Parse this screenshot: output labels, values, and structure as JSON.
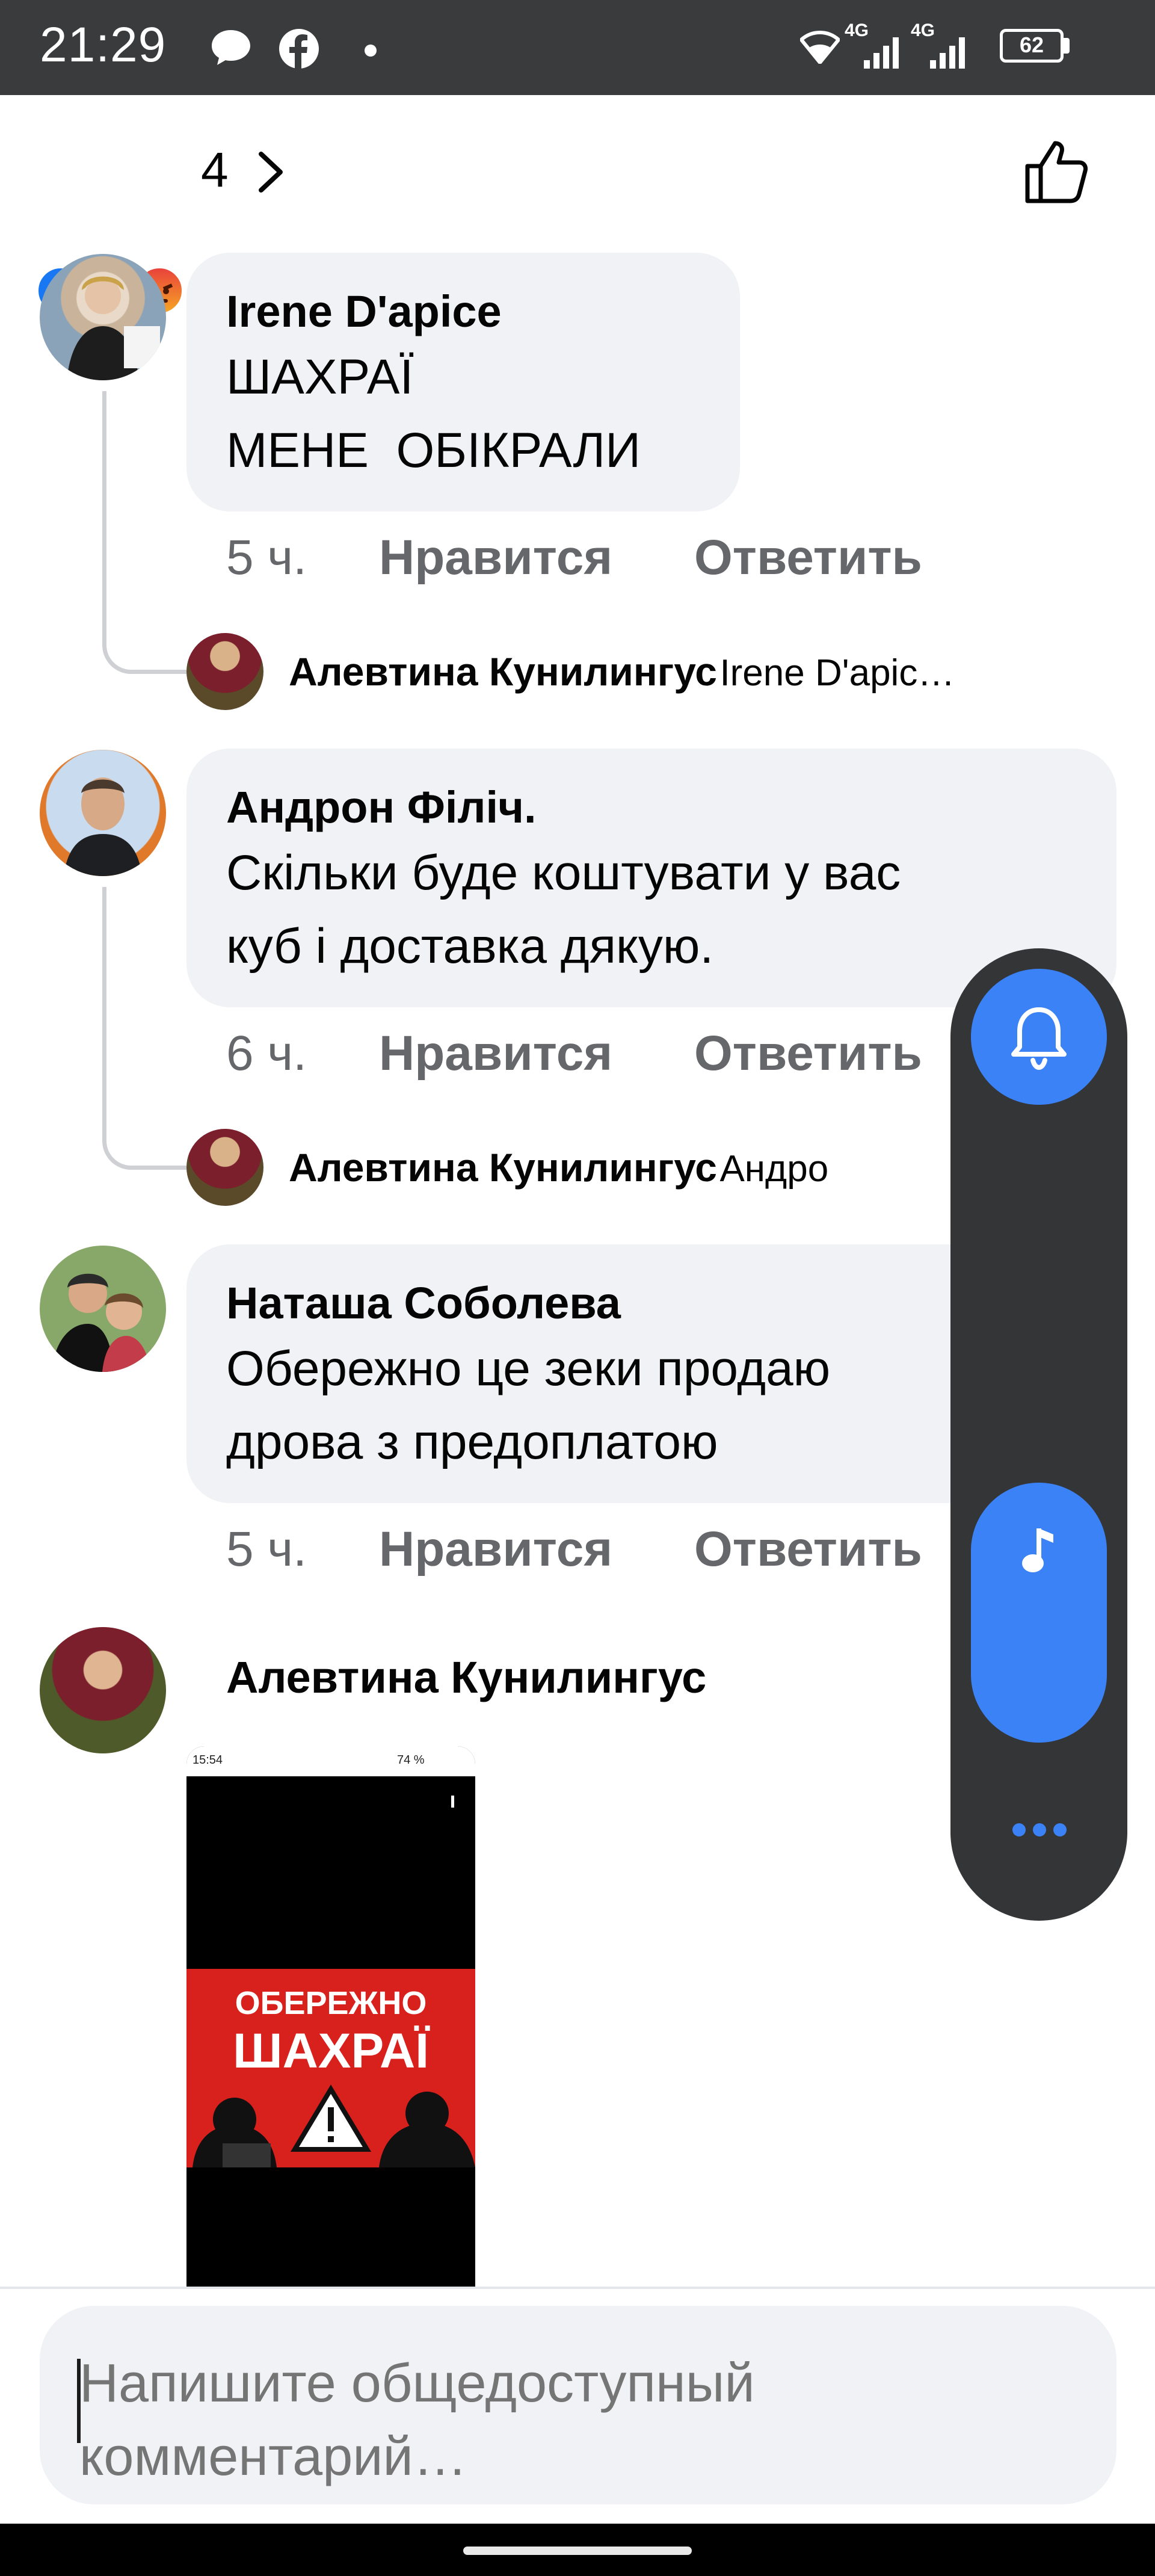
{
  "status_bar": {
    "time": "21:29",
    "left_icons": [
      "chat-bubble-icon",
      "facebook-icon",
      "dot-icon"
    ],
    "network_1": "4G",
    "network_2": "4G",
    "battery": "62"
  },
  "post_reactions": {
    "icons": [
      "like-reaction-icon",
      "haha-reaction-icon",
      "angry-reaction-icon"
    ],
    "count": "4"
  },
  "comments": [
    {
      "author": "Irene D'apice",
      "text": "ШАХРАЇ\nМЕНЕ  ОБІКРАЛИ",
      "time": "5 ч.",
      "like_label": "Нравится",
      "reply_label": "Ответить",
      "reply_preview": {
        "name": "Алевтина Кунилингус",
        "text": "Irene D'apic…"
      }
    },
    {
      "author": "Андрон Філіч.",
      "text": "Скільки буде коштувати у вас\nкуб і доставка дякую.",
      "time": "6 ч.",
      "like_label": "Нравится",
      "reply_label": "Ответить",
      "reply_preview": {
        "name": "Алевтина Кунилингус",
        "text": "Андро"
      }
    },
    {
      "author": "Наташа Соболева",
      "text": "Обережно це зеки продаю\nдрова з предоплатою",
      "time": "5 ч.",
      "like_label": "Нравится",
      "reply_label": "Ответить"
    },
    {
      "author": "Алевтина Кунилингус",
      "image": {
        "status_time": "15:54",
        "status_battery": "74 %",
        "warning_line1": "ОБЕРЕЖНО",
        "warning_line2": "ШАХРАЇ"
      }
    }
  ],
  "floating_panel": {
    "buttons": [
      "bell-icon",
      "music-note-icon",
      "more-dots-icon"
    ]
  },
  "composer": {
    "placeholder": "Напишите общедоступный комментарий…"
  },
  "colors": {
    "bubble": "#f0f2f5",
    "meta_text": "#65676b",
    "accent_blue": "#3b82f6",
    "panel_dark": "#343536",
    "status_bar": "#3a3b3c"
  }
}
